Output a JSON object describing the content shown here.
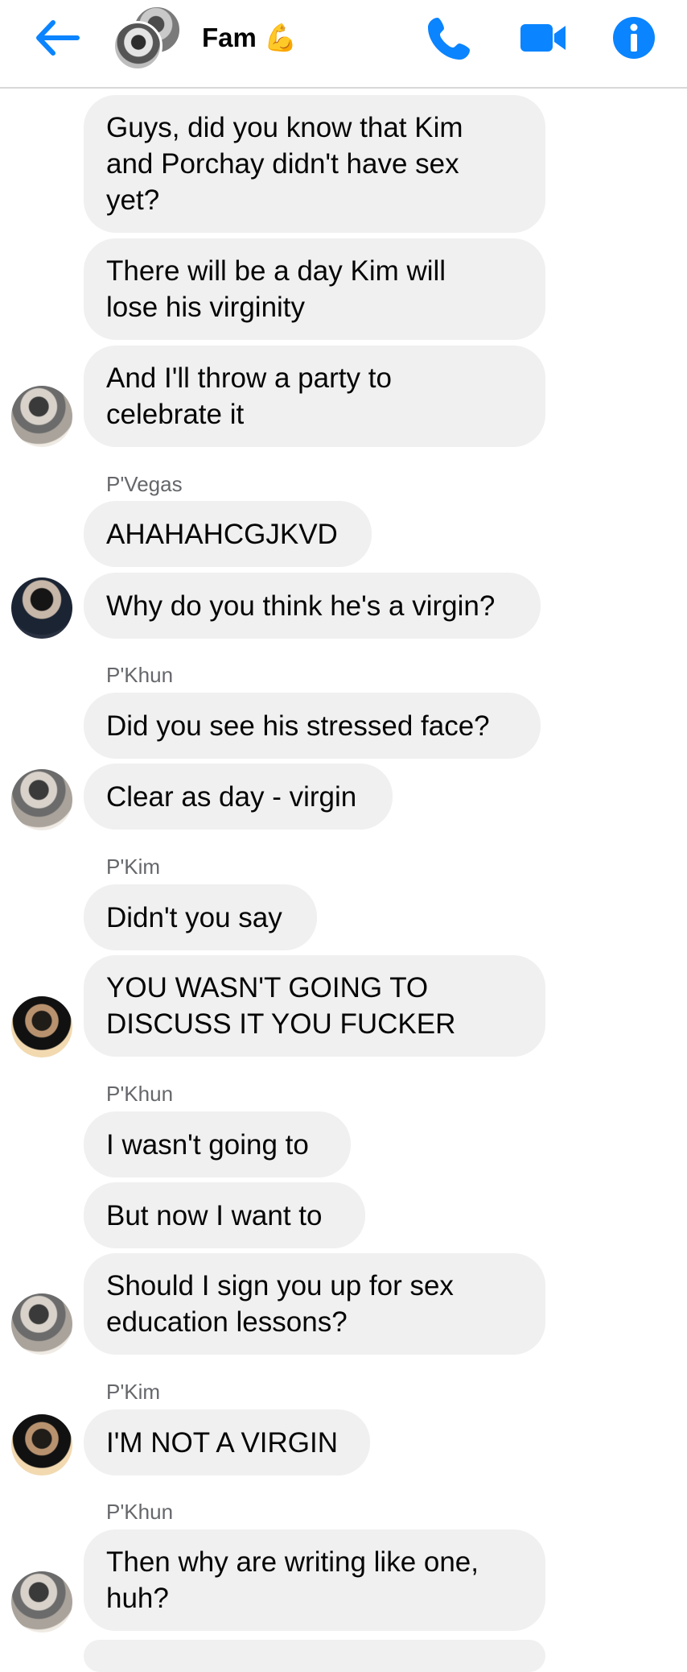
{
  "header": {
    "title": "Fam 💪",
    "back_icon": "arrow-left-icon",
    "call_icon": "phone-icon",
    "video_icon": "video-camera-icon",
    "info_icon": "info-icon",
    "accent_color": "#0a84ff"
  },
  "messages": [
    {
      "text": "Guys, did you know that Kim\nand Porchay didn't have sex\nyet?"
    },
    {
      "text": "There will be a day Kim will\nlose his virginity"
    },
    {
      "text": "And I'll throw a party to\ncelebrate it"
    },
    {
      "sender": "P'Vegas"
    },
    {
      "text": "AHAHAHCGJKVD"
    },
    {
      "text": "Why do you think he's a virgin?"
    },
    {
      "sender": "P'Khun"
    },
    {
      "text": "Did you see his stressed face?"
    },
    {
      "text": "Clear as day - virgin"
    },
    {
      "sender": "P'Kim"
    },
    {
      "text": "Didn't you say"
    },
    {
      "text": "YOU WASN'T GOING TO\nDISCUSS IT YOU FUCKER"
    },
    {
      "sender": "P'Khun"
    },
    {
      "text": "I wasn't going to"
    },
    {
      "text": "But now I want to"
    },
    {
      "text": "Should I sign you up for sex\neducation lessons?"
    },
    {
      "sender": "P'Kim"
    },
    {
      "text": "I'M NOT A VIRGIN"
    },
    {
      "sender": "P'Khun"
    },
    {
      "text": "Then why are writing like one,\nhuh?"
    }
  ]
}
